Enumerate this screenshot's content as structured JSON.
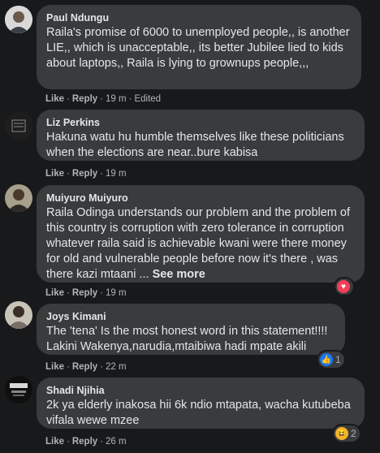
{
  "comments": [
    {
      "author": "Paul Ndungu",
      "text": "Raila's promise of 6000 to unemployed people,, is another LIE,, which is unacceptable,, its better Jubilee lied to kids about laptops,, Raila is lying to grownups people,,,",
      "like": "Like",
      "reply": "Reply",
      "time": "19 m",
      "edited": "Edited"
    },
    {
      "author": "Liz Perkins",
      "text": "Hakuna watu hu humble themselves like these politicians when the elections are near..bure kabisa",
      "like": "Like",
      "reply": "Reply",
      "time": "19 m"
    },
    {
      "author": "Muiyuro Muiyuro",
      "text": "Raila Odinga understands our problem and the problem of this country is corruption with zero tolerance in corruption whatever raila said is achievable kwani were there money for old and vulnerable people before now it's there , was there kazi mtaani ...",
      "see_more": "See more",
      "like": "Like",
      "reply": "Reply",
      "time": "19 m",
      "reaction": {
        "icon": "heart-icon",
        "count": ""
      }
    },
    {
      "author": "Joys Kimani",
      "text": "The 'tena' Is the most honest word in this statement!!!! Lakini Wakenya,narudia,mtaibiwa hadi mpate akili",
      "like": "Like",
      "reply": "Reply",
      "time": "22 m",
      "reaction": {
        "icon": "like-icon",
        "count": "1"
      }
    },
    {
      "author": "Shadi Njihia",
      "text": "2k ya elderly inakosa hii 6k ndio mtapata, wacha kutubeba vifala wewe mzee",
      "like": "Like",
      "reply": "Reply",
      "time": "26 m",
      "reaction": {
        "icon": "haha-icon",
        "count": "2"
      }
    }
  ],
  "colors": {
    "background": "#18191a",
    "bubble": "#3a3b3c",
    "text": "#e4e6eb",
    "secondary": "#b0b3b8",
    "heart": "#f33e58",
    "like": "#1877f2"
  }
}
